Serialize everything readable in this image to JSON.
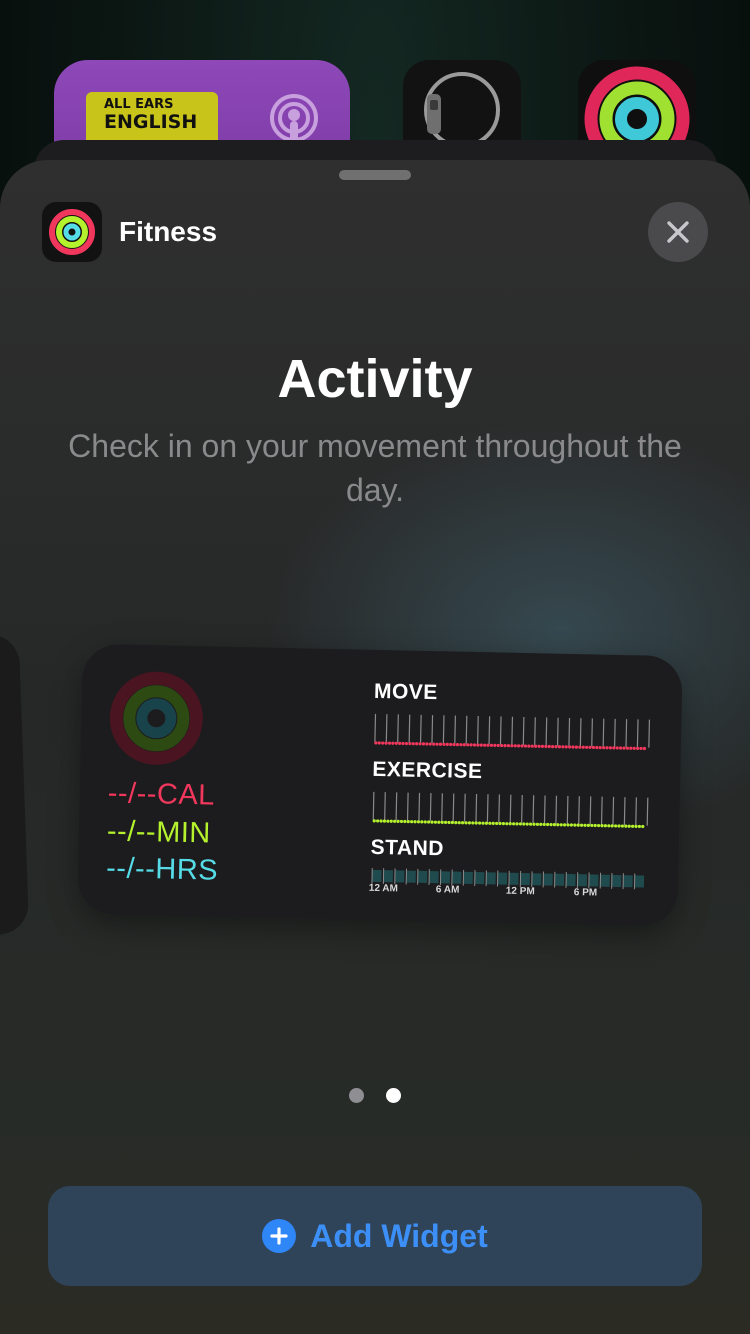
{
  "background": {
    "podcast_widget": {
      "cover_line1": "ALL EARS",
      "cover_line2": "ENGLISH",
      "icon": "podcasts-icon"
    },
    "watch_widget": {
      "icon": "apple-watch-icon"
    },
    "fitness_app": {
      "icon": "activity-rings-icon"
    }
  },
  "sheet": {
    "app_name": "Fitness",
    "app_icon": "activity-rings-icon",
    "close_icon": "close-icon",
    "title": "Activity",
    "description": "Check in on your movement throughout the day."
  },
  "widget": {
    "stats": {
      "cal": "--/--CAL",
      "min": "--/--MIN",
      "hrs": "--/--HRS"
    },
    "metrics": {
      "move": "MOVE",
      "exercise": "EXERCISE",
      "stand": "STAND"
    },
    "time_labels": [
      "12 AM",
      "6 AM",
      "12 PM",
      "6 PM"
    ],
    "colors": {
      "move": "#f2375d",
      "exercise": "#b5f22e",
      "stand": "#55dce6"
    }
  },
  "pagination": {
    "count": 2,
    "active_index": 1
  },
  "add_widget": {
    "label": "Add Widget",
    "icon": "plus-circle-icon",
    "color": "#3d8ff8"
  }
}
